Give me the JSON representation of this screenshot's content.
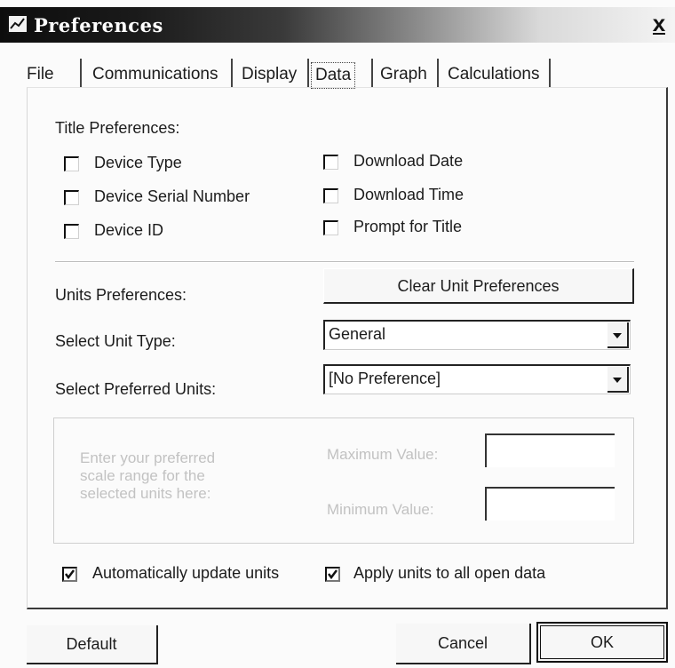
{
  "window": {
    "title": "Preferences",
    "close_label": "x"
  },
  "tabs": [
    "File",
    "Communications",
    "Display",
    "Data",
    "Graph",
    "Calculations"
  ],
  "active_tab": "Data",
  "title_preferences": {
    "heading": "Title Preferences:",
    "options": [
      {
        "label": "Device Type",
        "checked": false
      },
      {
        "label": "Device Serial Number",
        "checked": false
      },
      {
        "label": "Device ID",
        "checked": false
      },
      {
        "label": "Download Date",
        "checked": false
      },
      {
        "label": "Download Time",
        "checked": false
      },
      {
        "label": "Prompt for Title",
        "checked": false
      }
    ]
  },
  "units_preferences": {
    "heading": "Units Preferences:",
    "clear_button": "Clear Unit Preferences",
    "unit_type_label": "Select Unit Type:",
    "unit_type_value": "General",
    "preferred_units_label": "Select Preferred Units:",
    "preferred_units_value": "[No Preference]"
  },
  "scale_range": {
    "instructions": [
      "Enter your preferred",
      "scale range for the",
      "selected units here:"
    ],
    "max_label": "Maximum Value:",
    "min_label": "Minimum Value:"
  },
  "options": {
    "auto_update": {
      "label": "Automatically update units",
      "checked": true
    },
    "apply_all": {
      "label": "Apply units to all open data",
      "checked": true
    }
  },
  "buttons": {
    "default": "Default",
    "cancel": "Cancel",
    "ok": "OK"
  }
}
